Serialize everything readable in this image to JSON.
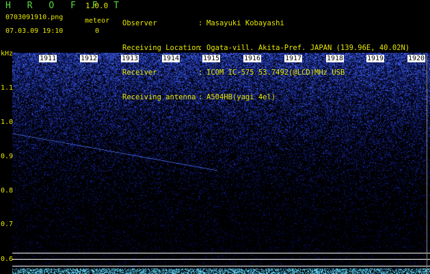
{
  "app": {
    "title": "H R O F F T",
    "version": "1.0.0"
  },
  "file_name": "0703091910.png",
  "timestamp": "07.03.09 19:10",
  "meteor": {
    "label": "meteor",
    "count": "0"
  },
  "info": [
    {
      "label": "Observer",
      "colon": ":",
      "value": "Masayuki Kobayashi"
    },
    {
      "label": "Receiving Location",
      "colon": ":",
      "value": "Ogata-vill. Akita-Pref. JAPAN (139.96E, 40.02N)"
    },
    {
      "label": "Receiver",
      "colon": ":",
      "value": "ICOM IC-575 53.7492(@LCD)MHz USB"
    },
    {
      "label": "Receiving antenna",
      "colon": ":",
      "value": "A504HB(yagi 4el)"
    }
  ],
  "axis": {
    "unit": "kHz",
    "y_ticks": [
      "1.1",
      "1.0",
      "0.9",
      "0.8",
      "0.7",
      "0.6"
    ],
    "minute_labels": [
      "1911",
      "1912",
      "1913",
      "1914",
      "1915",
      "1916",
      "1917",
      "1918",
      "1919",
      "1920"
    ]
  },
  "colors": {
    "background": "#000000",
    "text": "#e6e600",
    "title": "#59d93f",
    "signal": "#1e2fd0"
  }
}
